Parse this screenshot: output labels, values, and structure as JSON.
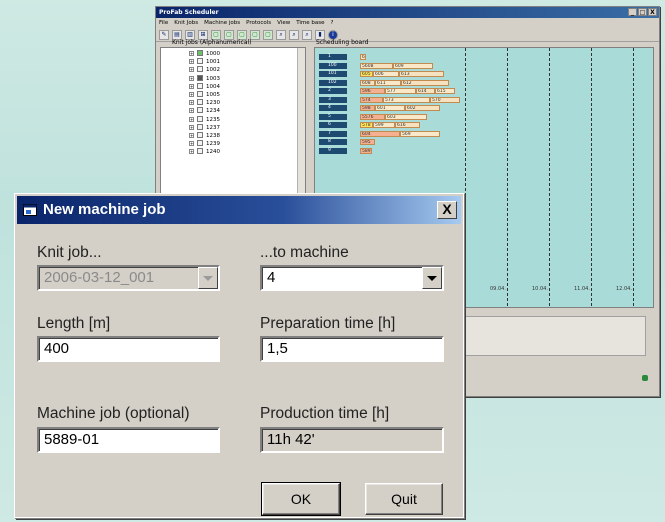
{
  "main_window": {
    "title": "ProFab Scheduler",
    "controls": [
      "_",
      "□",
      "X"
    ],
    "menu": [
      "File",
      "Knit Jobs",
      "Machine jobs",
      "Protocols",
      "View",
      "Time base",
      "?"
    ],
    "tree_label": "Knit jobs (Alphanumerical)",
    "board_label": "Scheduling board",
    "knit_jobs": [
      "1000",
      "1001",
      "1002",
      "1003",
      "1004",
      "1005",
      "1230",
      "1234",
      "1235",
      "1237",
      "1238",
      "1239",
      "1240"
    ],
    "board_rows": [
      {
        "machine": "1",
        "jobs": [
          {
            "label": "606"
          }
        ]
      },
      {
        "machine": "100",
        "jobs": [
          {
            "label": "5608"
          },
          {
            "label": "609"
          }
        ]
      },
      {
        "machine": "101",
        "jobs": [
          {
            "label": "605"
          },
          {
            "label": "606"
          },
          {
            "label": "613"
          }
        ]
      },
      {
        "machine": "102",
        "jobs": [
          {
            "label": "608"
          },
          {
            "label": "611"
          },
          {
            "label": "612"
          }
        ]
      },
      {
        "machine": "2",
        "jobs": [
          {
            "label": "596"
          },
          {
            "label": "577"
          },
          {
            "label": "614"
          },
          {
            "label": "615"
          }
        ]
      },
      {
        "machine": "3",
        "jobs": [
          {
            "label": "574"
          },
          {
            "label": "573"
          },
          {
            "label": "570"
          }
        ]
      },
      {
        "machine": "4",
        "jobs": [
          {
            "label": "598"
          },
          {
            "label": "601"
          },
          {
            "label": "602"
          }
        ]
      },
      {
        "machine": "5",
        "jobs": [
          {
            "label": "5576"
          },
          {
            "label": "603"
          }
        ]
      },
      {
        "machine": "6",
        "jobs": [
          {
            "label": "578"
          },
          {
            "label": "599"
          },
          {
            "label": "616"
          }
        ]
      },
      {
        "machine": "7",
        "jobs": [
          {
            "label": "604"
          },
          {
            "label": "569"
          }
        ]
      },
      {
        "machine": "8",
        "jobs": [
          {
            "label": "595"
          }
        ]
      },
      {
        "machine": "9",
        "jobs": [
          {
            "label": "589"
          }
        ]
      }
    ],
    "time_ticks": [
      "09.04.",
      "10.04.",
      "11.04.",
      "12.04."
    ]
  },
  "dialog": {
    "title": "New machine job",
    "close_label": "X",
    "knit_job": {
      "label": "Knit job...",
      "value": "2006-03-12_001"
    },
    "to_machine": {
      "label": "...to machine",
      "value": "4"
    },
    "length": {
      "label": "Length [m]",
      "value": "400"
    },
    "prep_time": {
      "label": "Preparation time [h]",
      "value": "1,5"
    },
    "machine_job": {
      "label": "Machine job (optional)",
      "value": "5889-01"
    },
    "prod_time": {
      "label": "Production time [h]",
      "value": "11h 42'"
    },
    "ok_label": "OK",
    "quit_label": "Quit"
  }
}
